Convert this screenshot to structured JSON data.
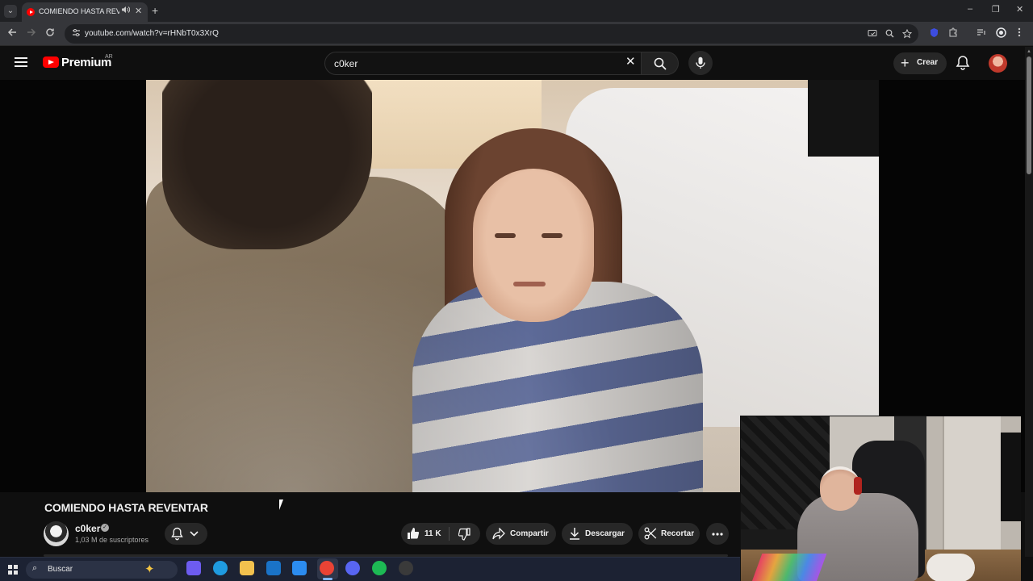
{
  "browser": {
    "tab": {
      "title": "COMIENDO HASTA REVENTAR",
      "audio_icon": "speaker-icon",
      "close_glyph": "✕"
    },
    "new_tab_glyph": "+",
    "window_controls": [
      "–",
      "❐",
      "✕"
    ],
    "address": "youtube.com/watch?v=rHNbT0x3XrQ"
  },
  "youtube": {
    "logo_text": "Premium",
    "country": "AR",
    "search": {
      "value": "c0ker",
      "clear_glyph": "✕"
    },
    "create_label": "Crear",
    "create_glyph": "+"
  },
  "video": {
    "title": "COMIENDO HASTA REVENTAR",
    "channel": {
      "name": "c0ker",
      "verified_glyph": "✓",
      "subscribers": "1,03 M de suscriptores"
    },
    "actions": {
      "likes": "11 K",
      "share": "Compartir",
      "download": "Descargar",
      "clip": "Recortar"
    }
  },
  "taskbar": {
    "search_label": "Buscar",
    "search_glyph": "⌕",
    "copilot_glyph": "✦",
    "apps": [
      {
        "name": "copilot-icon",
        "color": "#6d5cf0"
      },
      {
        "name": "edge-icon",
        "color": "#1f9be0"
      },
      {
        "name": "file-explorer-icon",
        "color": "#f2c14e"
      },
      {
        "name": "outlook-icon",
        "color": "#1a73c8"
      },
      {
        "name": "store-icon",
        "color": "#2c8cf0"
      },
      {
        "name": "chrome-icon",
        "color": "#e94335"
      },
      {
        "name": "discord-icon",
        "color": "#5865f2"
      },
      {
        "name": "spotify-icon",
        "color": "#1db954"
      },
      {
        "name": "obs-icon",
        "color": "#3a3a3a"
      }
    ]
  },
  "colors": {
    "youtube_red": "#ff0000",
    "page_bg": "#0f0f0f",
    "chip_bg": "#272727"
  }
}
